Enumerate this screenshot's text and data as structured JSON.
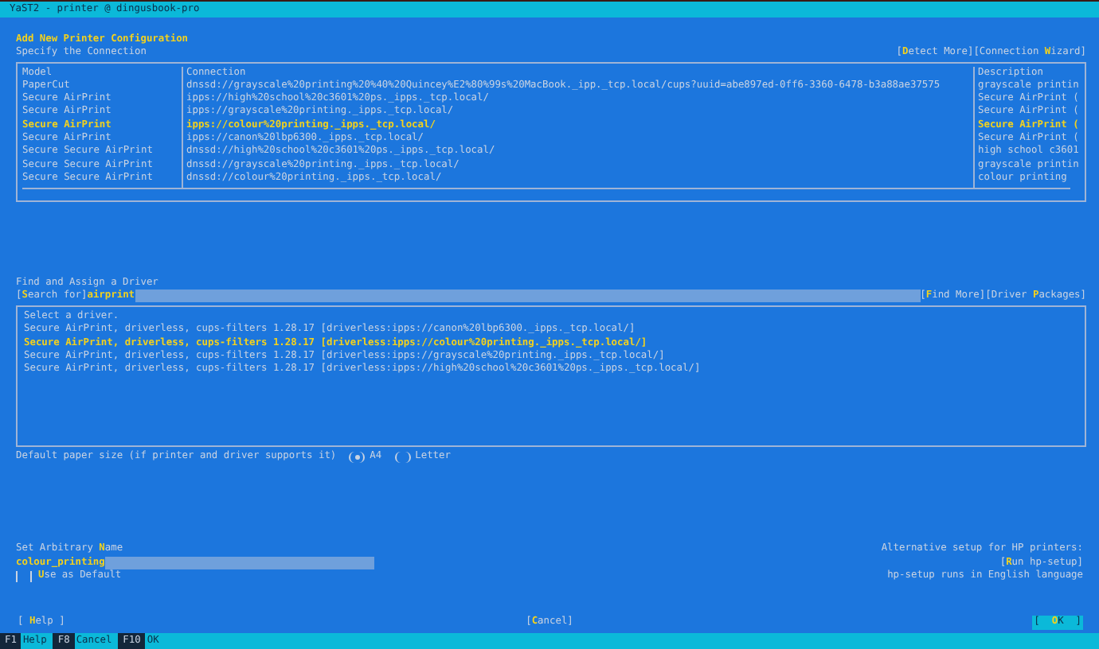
{
  "window": {
    "title": "YaST2 - printer @ dingusbook-pro"
  },
  "heading": "Add New Printer Configuration",
  "connection_section": {
    "label": "Specify the Connection",
    "buttons": [
      "[**D**etect More]",
      "[Connection **W**izard]"
    ]
  },
  "connections": {
    "columns": [
      "Model",
      "Connection",
      "Description"
    ],
    "rows": [
      {
        "model": "PaperCut",
        "connection": "dnssd://grayscale%20printing%20%40%20Quincey%E2%80%99s%20MacBook._ipp._tcp.local/cups?uuid=abe897ed-0ff6-3360-6478-b3a88ae37575",
        "description": "grayscale printin",
        "selected": false
      },
      {
        "model": "Secure AirPrint",
        "connection": "ipps://high%20school%20c3601%20ps._ipps._tcp.local/",
        "description": "Secure AirPrint (",
        "selected": false
      },
      {
        "model": "Secure AirPrint",
        "connection": "ipps://grayscale%20printing._ipps._tcp.local/",
        "description": "Secure AirPrint (",
        "selected": false
      },
      {
        "model": "Secure AirPrint",
        "connection": "ipps://colour%20printing._ipps._tcp.local/",
        "description": "Secure AirPrint (",
        "selected": true
      },
      {
        "model": "Secure AirPrint",
        "connection": "ipps://canon%20lbp6300._ipps._tcp.local/",
        "description": "Secure AirPrint (",
        "selected": false
      },
      {
        "model": "Secure Secure AirPrint",
        "connection": "dnssd://high%20school%20c3601%20ps._ipps._tcp.local/",
        "description": "high school c3601",
        "selected": false
      },
      {
        "model": "Secure Secure AirPrint",
        "connection": "dnssd://grayscale%20printing._ipps._tcp.local/",
        "description": "grayscale printin",
        "selected": false
      },
      {
        "model": "Secure Secure AirPrint",
        "connection": "dnssd://colour%20printing._ipps._tcp.local/",
        "description": "colour printing",
        "selected": false
      }
    ]
  },
  "driver_section": {
    "label": "Find and Assign a Driver",
    "search_label": "[**S**earch for]",
    "search_value": "airprint",
    "buttons": [
      "[**F**ind More]",
      "[Driver **P**ackages]"
    ],
    "list_label": "Select a driver.",
    "drivers": [
      {
        "text": "Secure AirPrint, driverless, cups-filters 1.28.17 [driverless:ipps://canon%20lbp6300._ipps._tcp.local/]",
        "selected": false
      },
      {
        "text": "Secure AirPrint, driverless, cups-filters 1.28.17 [driverless:ipps://colour%20printing._ipps._tcp.local/]",
        "selected": true
      },
      {
        "text": "Secure AirPrint, driverless, cups-filters 1.28.17 [driverless:ipps://grayscale%20printing._ipps._tcp.local/]",
        "selected": false
      },
      {
        "text": "Secure AirPrint, driverless, cups-filters 1.28.17 [driverless:ipps://high%20school%20c3601%20ps._ipps._tcp.local/]",
        "selected": false
      }
    ]
  },
  "paper_size": {
    "label": "Default paper size (if printer and driver supports it)",
    "options": [
      {
        "label": "A4",
        "selected": true
      },
      {
        "label": "Letter",
        "selected": false
      }
    ]
  },
  "name_section": {
    "label": "Set Arbitrary **N**ame",
    "value": "colour_printing",
    "default_checkbox": {
      "label": "**U**se as Default",
      "checked": false
    }
  },
  "hp_section": {
    "label": "Alternative setup for HP printers:",
    "button": "[**R**un hp-setup]",
    "note": "hp-setup runs in English language"
  },
  "buttons": [
    {
      "label": "[ **H**elp ]",
      "kind": "plain"
    },
    {
      "label": "[**C**ancel]",
      "kind": "plain"
    },
    {
      "label": "[  **O**K  ]",
      "kind": "focused"
    }
  ],
  "function_keys": [
    {
      "key": "F1",
      "label": "Help"
    },
    {
      "key": "F8",
      "label": "Cancel"
    },
    {
      "key": "F10",
      "label": "OK"
    }
  ]
}
